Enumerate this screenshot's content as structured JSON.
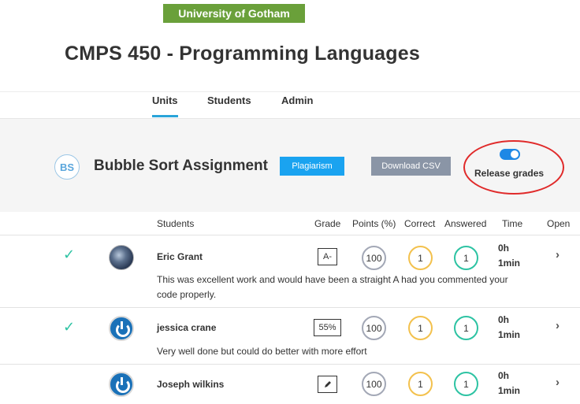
{
  "header": {
    "university": "University of Gotham",
    "course_title": "CMPS 450 - Programming Languages"
  },
  "tabs": [
    {
      "label": "Units",
      "active": true
    },
    {
      "label": "Students",
      "active": false
    },
    {
      "label": "Admin",
      "active": false
    }
  ],
  "assignment": {
    "initials": "BS",
    "title": "Bubble Sort Assignment",
    "plagiarism_label": "Plagiarism",
    "download_label": "Download CSV",
    "release_label": "Release grades",
    "release_on": true
  },
  "columns": {
    "students": "Students",
    "grade": "Grade",
    "points": "Points (%)",
    "correct": "Correct",
    "answered": "Answered",
    "time": "Time",
    "open": "Open"
  },
  "students": [
    {
      "name": "Eric Grant",
      "grade": "A-",
      "points": "100",
      "correct": "1",
      "answered": "1",
      "time_h": "0h",
      "time_m": "1min",
      "checked": true,
      "avatar": "globe-avatar",
      "comment": "This was excellent work and would have been a straight A had you commented your code properly."
    },
    {
      "name": "jessica crane",
      "grade": "55%",
      "points": "100",
      "correct": "1",
      "answered": "1",
      "time_h": "0h",
      "time_m": "1min",
      "checked": true,
      "avatar": "power-avatar",
      "comment": "Very well done but could do better with more effort"
    },
    {
      "name": "Joseph wilkins",
      "grade": "",
      "grade_icon": "pencil-icon",
      "points": "100",
      "correct": "1",
      "answered": "1",
      "time_h": "0h",
      "time_m": "1min",
      "checked": false,
      "avatar": "power-avatar",
      "comment": ""
    }
  ],
  "colors": {
    "brand_green": "#6aa03a",
    "accent_blue": "#1aa3f0",
    "tab_underline": "#2aa4d9",
    "points_ring": "#a3a8b6",
    "correct_ring": "#f3c14d",
    "answered_ring": "#2dc3a3",
    "highlight_ring": "#e02a2a"
  },
  "icons": {
    "check": "check-icon",
    "chevron": "chevron-right-icon"
  }
}
